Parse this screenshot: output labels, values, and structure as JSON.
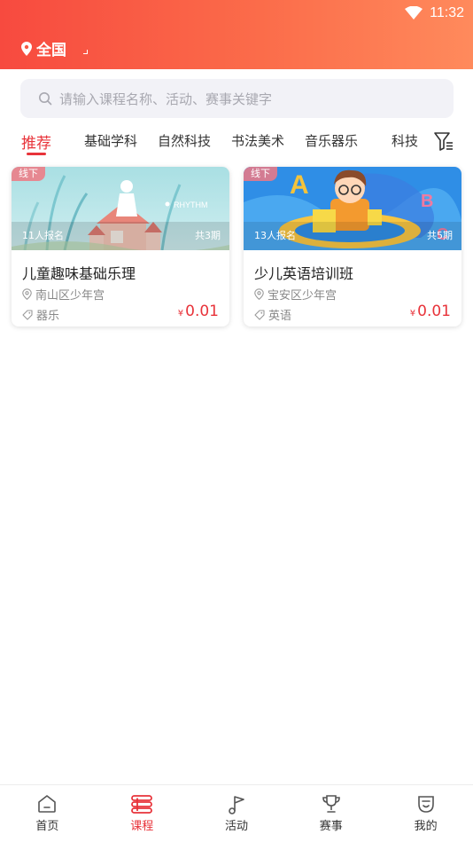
{
  "status": {
    "time": "11:32"
  },
  "location": {
    "label": "全国"
  },
  "search": {
    "placeholder": "请输入课程名称、活动、赛事关键字"
  },
  "tabs": [
    {
      "label": "推荐",
      "active": true
    },
    {
      "label": "基础学科"
    },
    {
      "label": "自然科技"
    },
    {
      "label": "书法美术"
    },
    {
      "label": "音乐器乐"
    },
    {
      "label": "科技"
    }
  ],
  "courses": [
    {
      "badge": "线下",
      "enrolled": "11人报名",
      "periods": "共3期",
      "thumb_caption": "RHYTHM",
      "title": "儿童趣味基础乐理",
      "place": "南山区少年宫",
      "category": "器乐",
      "currency": "¥",
      "price": "0.01"
    },
    {
      "badge": "线下",
      "enrolled": "13人报名",
      "periods": "共5期",
      "thumb_caption": "",
      "title": "少儿英语培训班",
      "place": "宝安区少年宫",
      "category": "英语",
      "currency": "¥",
      "price": "0.01"
    }
  ],
  "bottom_nav": [
    {
      "label": "首页",
      "icon": "home-icon"
    },
    {
      "label": "课程",
      "icon": "course-icon",
      "active": true
    },
    {
      "label": "活动",
      "icon": "activity-icon"
    },
    {
      "label": "赛事",
      "icon": "trophy-icon"
    },
    {
      "label": "我的",
      "icon": "profile-icon"
    }
  ],
  "colors": {
    "accent": "#e8333a",
    "header_start": "#f74a3f",
    "header_end": "#ff8a5c"
  }
}
